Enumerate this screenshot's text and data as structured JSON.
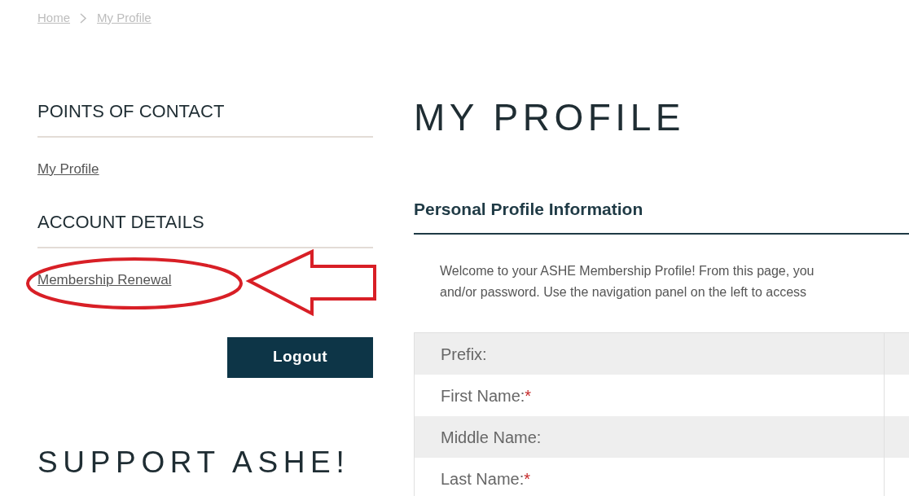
{
  "breadcrumb": [
    {
      "label": "Home"
    },
    {
      "label": "My Profile"
    }
  ],
  "sidebar": {
    "sections": [
      {
        "heading": "POINTS OF CONTACT",
        "links": [
          {
            "label": "My Profile",
            "annotated": false
          }
        ]
      },
      {
        "heading": "ACCOUNT DETAILS",
        "links": [
          {
            "label": "Membership Renewal",
            "annotated": true
          }
        ]
      }
    ],
    "logout_button": "Logout",
    "support_heading": "SUPPORT ASHE!"
  },
  "main": {
    "title": "MY PROFILE",
    "section_title": "Personal Profile Information",
    "intro_lines": [
      "Welcome to your ASHE Membership Profile! From this page, you",
      "and/or password. Use the navigation panel on the left to access"
    ],
    "rows": [
      {
        "label": "Prefix:"
      },
      {
        "label": "First Name:",
        "required_mark": "*"
      },
      {
        "label": "Middle Name:"
      },
      {
        "label": "Last Name:",
        "required_mark": "*"
      }
    ]
  }
}
